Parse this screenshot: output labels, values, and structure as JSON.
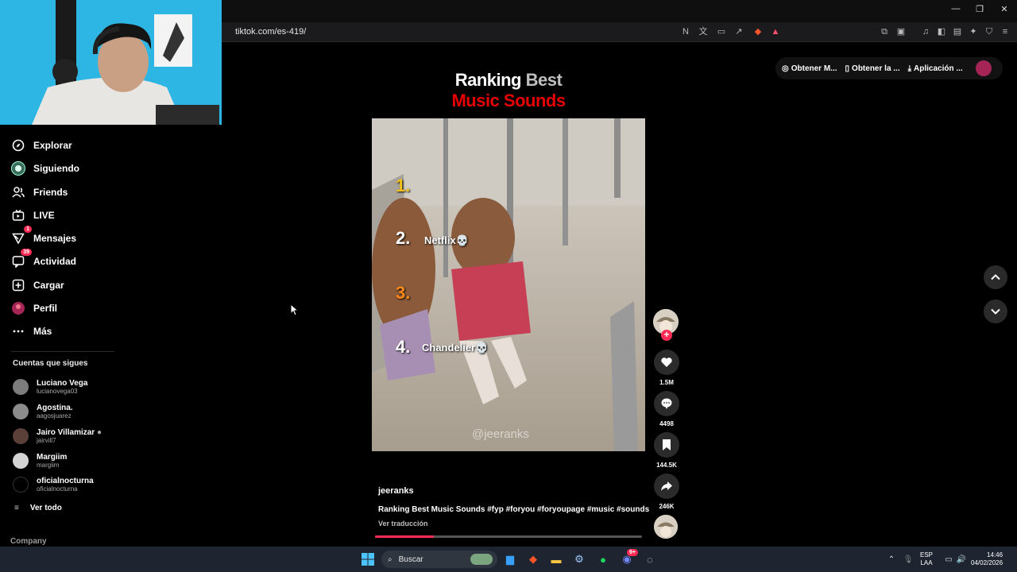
{
  "browser": {
    "url": "tiktok.com/es-419/",
    "window_controls": [
      "—",
      "❐",
      "✕"
    ]
  },
  "sidebar": {
    "items": [
      {
        "label": "Explorar",
        "icon": "compass-icon"
      },
      {
        "label": "Siguiendo",
        "icon": "following-avatar-icon"
      },
      {
        "label": "Friends",
        "icon": "friends-icon"
      },
      {
        "label": "LIVE",
        "icon": "live-tv-icon"
      },
      {
        "label": "Mensajes",
        "icon": "messages-icon",
        "badge": "1"
      },
      {
        "label": "Actividad",
        "icon": "activity-icon",
        "badge": "39"
      },
      {
        "label": "Cargar",
        "icon": "upload-icon"
      },
      {
        "label": "Perfil",
        "icon": "profile-avatar-icon"
      },
      {
        "label": "Más",
        "icon": "more-dots-icon"
      }
    ],
    "following_title": "Cuentas que sigues",
    "accounts": [
      {
        "name": "Luciano Vega",
        "handle": "lucianovega03"
      },
      {
        "name": "Agostina.",
        "handle": "aagosjuarez"
      },
      {
        "name": "Jairo Villamizar",
        "handle": "jairvill7"
      },
      {
        "name": "Margiim",
        "handle": "margiim"
      },
      {
        "name": "oficialnocturna",
        "handle": "oficialnocturna"
      }
    ],
    "see_all": "Ver todo",
    "company": "Company"
  },
  "top_pills": [
    "Obtener M...",
    "Obtener la ...",
    "Aplicación ..."
  ],
  "video": {
    "title_white": "Ranking ",
    "title_grey": "Best",
    "title_red": "Music Sounds",
    "ranks": [
      {
        "num": "1.",
        "label": "",
        "color": "#f3c21a"
      },
      {
        "num": "2.",
        "label": "Netflix💀",
        "color": "#ffffff"
      },
      {
        "num": "3.",
        "label": "",
        "color": "#ff8a1a"
      },
      {
        "num": "4.",
        "label": "Chandelier💀",
        "color": "#ffffff"
      }
    ],
    "watermark": "@jeeranks",
    "author": "jeeranks",
    "caption": "Ranking Best Music Sounds #fyp #foryou #foryoupage #music #sounds",
    "translate": "Ver traducción",
    "progress": 0.22
  },
  "actions": {
    "likes": "1.5M",
    "comments": "4498",
    "saves": "144.5K",
    "shares": "246K"
  },
  "taskbar": {
    "search": "Buscar",
    "lang_line1": "ESP",
    "lang_line2": "LAA",
    "time": "14:46",
    "date": "04/02/2026",
    "discord_badge": "9+"
  },
  "colors": {
    "accent": "#fe2c55",
    "red_title": "#e60000"
  }
}
